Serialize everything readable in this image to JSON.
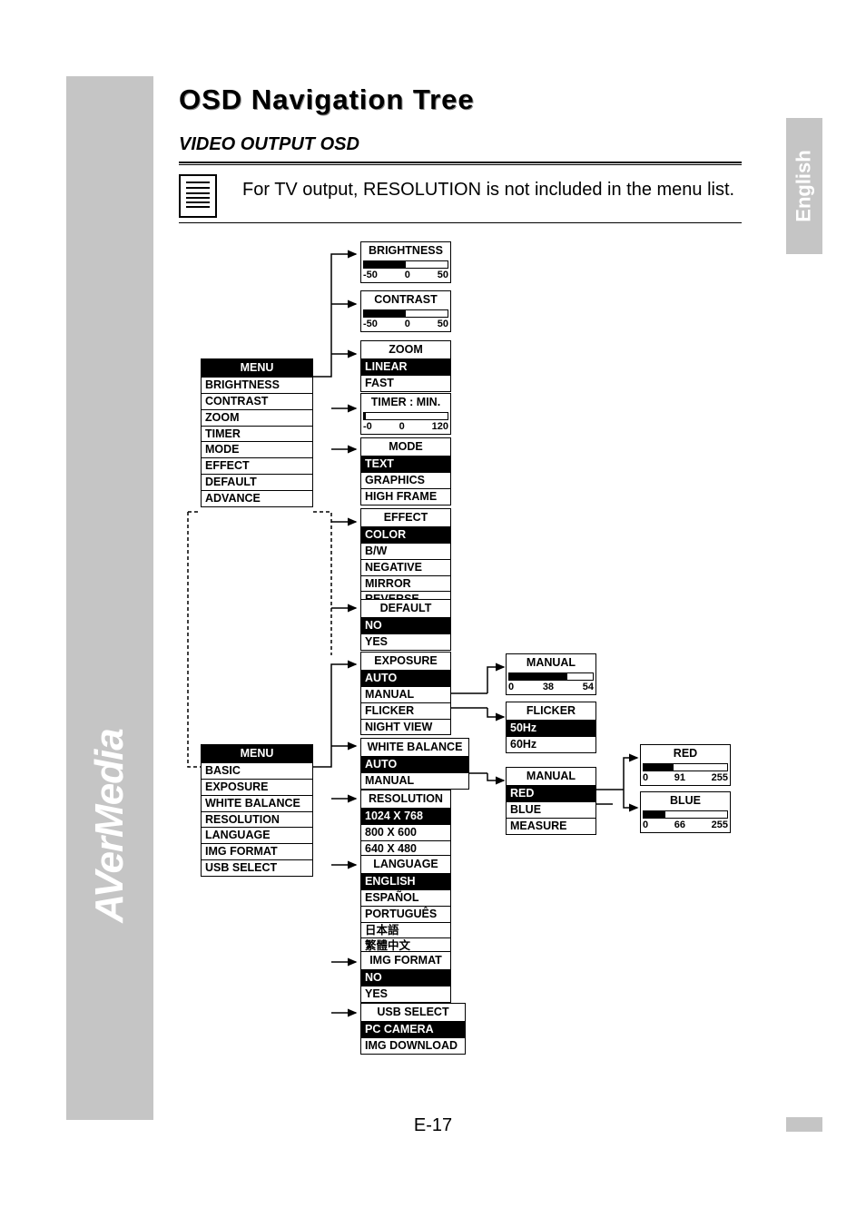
{
  "brand": "AVerMedia",
  "language_tab": "English",
  "title": "OSD Navigation Tree",
  "subtitle": "VIDEO OUTPUT OSD",
  "note": "For TV output, RESOLUTION is not included in the menu list.",
  "page_number": "E-17",
  "menu1": {
    "header": "MENU",
    "items": [
      "BRIGHTNESS",
      "CONTRAST",
      "ZOOM",
      "TIMER",
      "MODE",
      "EFFECT",
      "DEFAULT",
      "ADVANCE"
    ]
  },
  "menu2": {
    "header": "MENU",
    "items": [
      "BASIC",
      "EXPOSURE",
      "WHITE BALANCE",
      "RESOLUTION",
      "LANGUAGE",
      "IMG FORMAT",
      "USB SELECT"
    ]
  },
  "brightness": {
    "header": "BRIGHTNESS",
    "min": "-50",
    "mid": "0",
    "max": "50",
    "fill": 50
  },
  "contrast": {
    "header": "CONTRAST",
    "min": "-50",
    "mid": "0",
    "max": "50",
    "fill": 50
  },
  "zoom": {
    "header": "ZOOM",
    "sel": "LINEAR",
    "items": [
      "FAST"
    ]
  },
  "timer": {
    "header": "TIMER : MIN.",
    "min": "-0",
    "mid": "0",
    "max": "120",
    "fill": 0
  },
  "mode": {
    "header": "MODE",
    "sel": "TEXT",
    "items": [
      "GRAPHICS",
      "HIGH FRAME"
    ]
  },
  "effect": {
    "header": "EFFECT",
    "sel": "COLOR",
    "items": [
      "B/W",
      "NEGATIVE",
      "MIRROR",
      "REVERSE"
    ]
  },
  "default": {
    "header": "DEFAULT",
    "sel": "NO",
    "items": [
      "YES"
    ]
  },
  "exposure": {
    "header": "EXPOSURE",
    "sel": "AUTO",
    "items": [
      "MANUAL",
      "FLICKER",
      "NIGHT VIEW"
    ]
  },
  "whitebalance": {
    "header": "WHITE BALANCE",
    "sel": "AUTO",
    "items": [
      "MANUAL"
    ]
  },
  "resolution": {
    "header": "RESOLUTION",
    "sel": "1024 X 768",
    "items": [
      "800 X 600",
      "640 X 480"
    ]
  },
  "language": {
    "header": "LANGUAGE",
    "sel": "ENGLISH",
    "items": [
      "ESPAÑOL",
      "PORTUGUÊS",
      "日本語",
      "繁體中文"
    ]
  },
  "imgformat": {
    "header": "IMG FORMAT",
    "sel": "NO",
    "items": [
      "YES"
    ]
  },
  "usbselect": {
    "header": "USB SELECT",
    "sel": "PC CAMERA",
    "items": [
      "IMG DOWNLOAD"
    ]
  },
  "manual_exp": {
    "header": "MANUAL",
    "min": "0",
    "mid": "38",
    "max": "54",
    "fill": 70
  },
  "flicker": {
    "header": "FLICKER",
    "sel": "50Hz",
    "items": [
      "60Hz"
    ]
  },
  "wb_manual": {
    "header": "MANUAL",
    "sel": "RED",
    "items": [
      "BLUE",
      "MEASURE"
    ]
  },
  "red": {
    "header": "RED",
    "min": "0",
    "mid": "91",
    "max": "255",
    "fill": 36
  },
  "blue": {
    "header": "BLUE",
    "min": "0",
    "mid": "66",
    "max": "255",
    "fill": 26
  }
}
